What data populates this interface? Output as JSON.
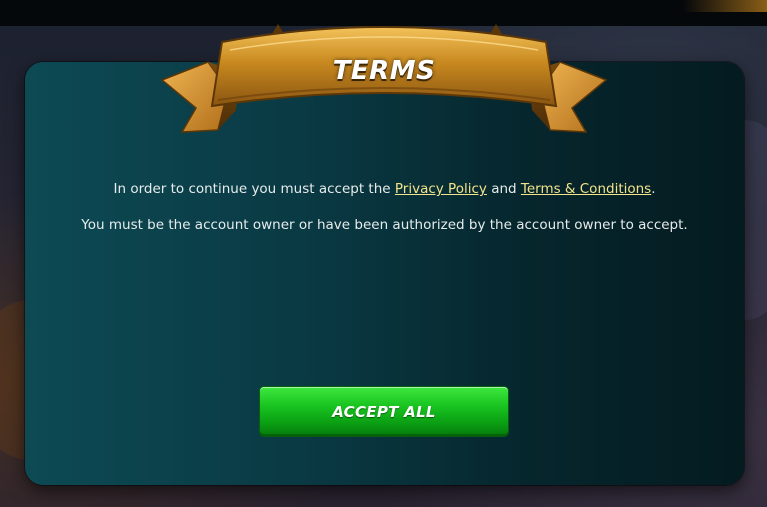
{
  "dialog": {
    "title": "TERMS",
    "line1_prefix": "In order to continue you must accept the ",
    "privacy_link": "Privacy Policy",
    "line1_middle": " and ",
    "terms_link": "Terms & Conditions",
    "line1_suffix": ".",
    "line2": "You must be the account owner or have been authorized by the account owner to accept.",
    "accept_button": "ACCEPT ALL"
  },
  "colors": {
    "panel": "#0a3a44",
    "link": "#f3e38a",
    "button": "#18c21f",
    "banner": "#c8891f"
  },
  "icons": {
    "banner": "ribbon-banner"
  }
}
